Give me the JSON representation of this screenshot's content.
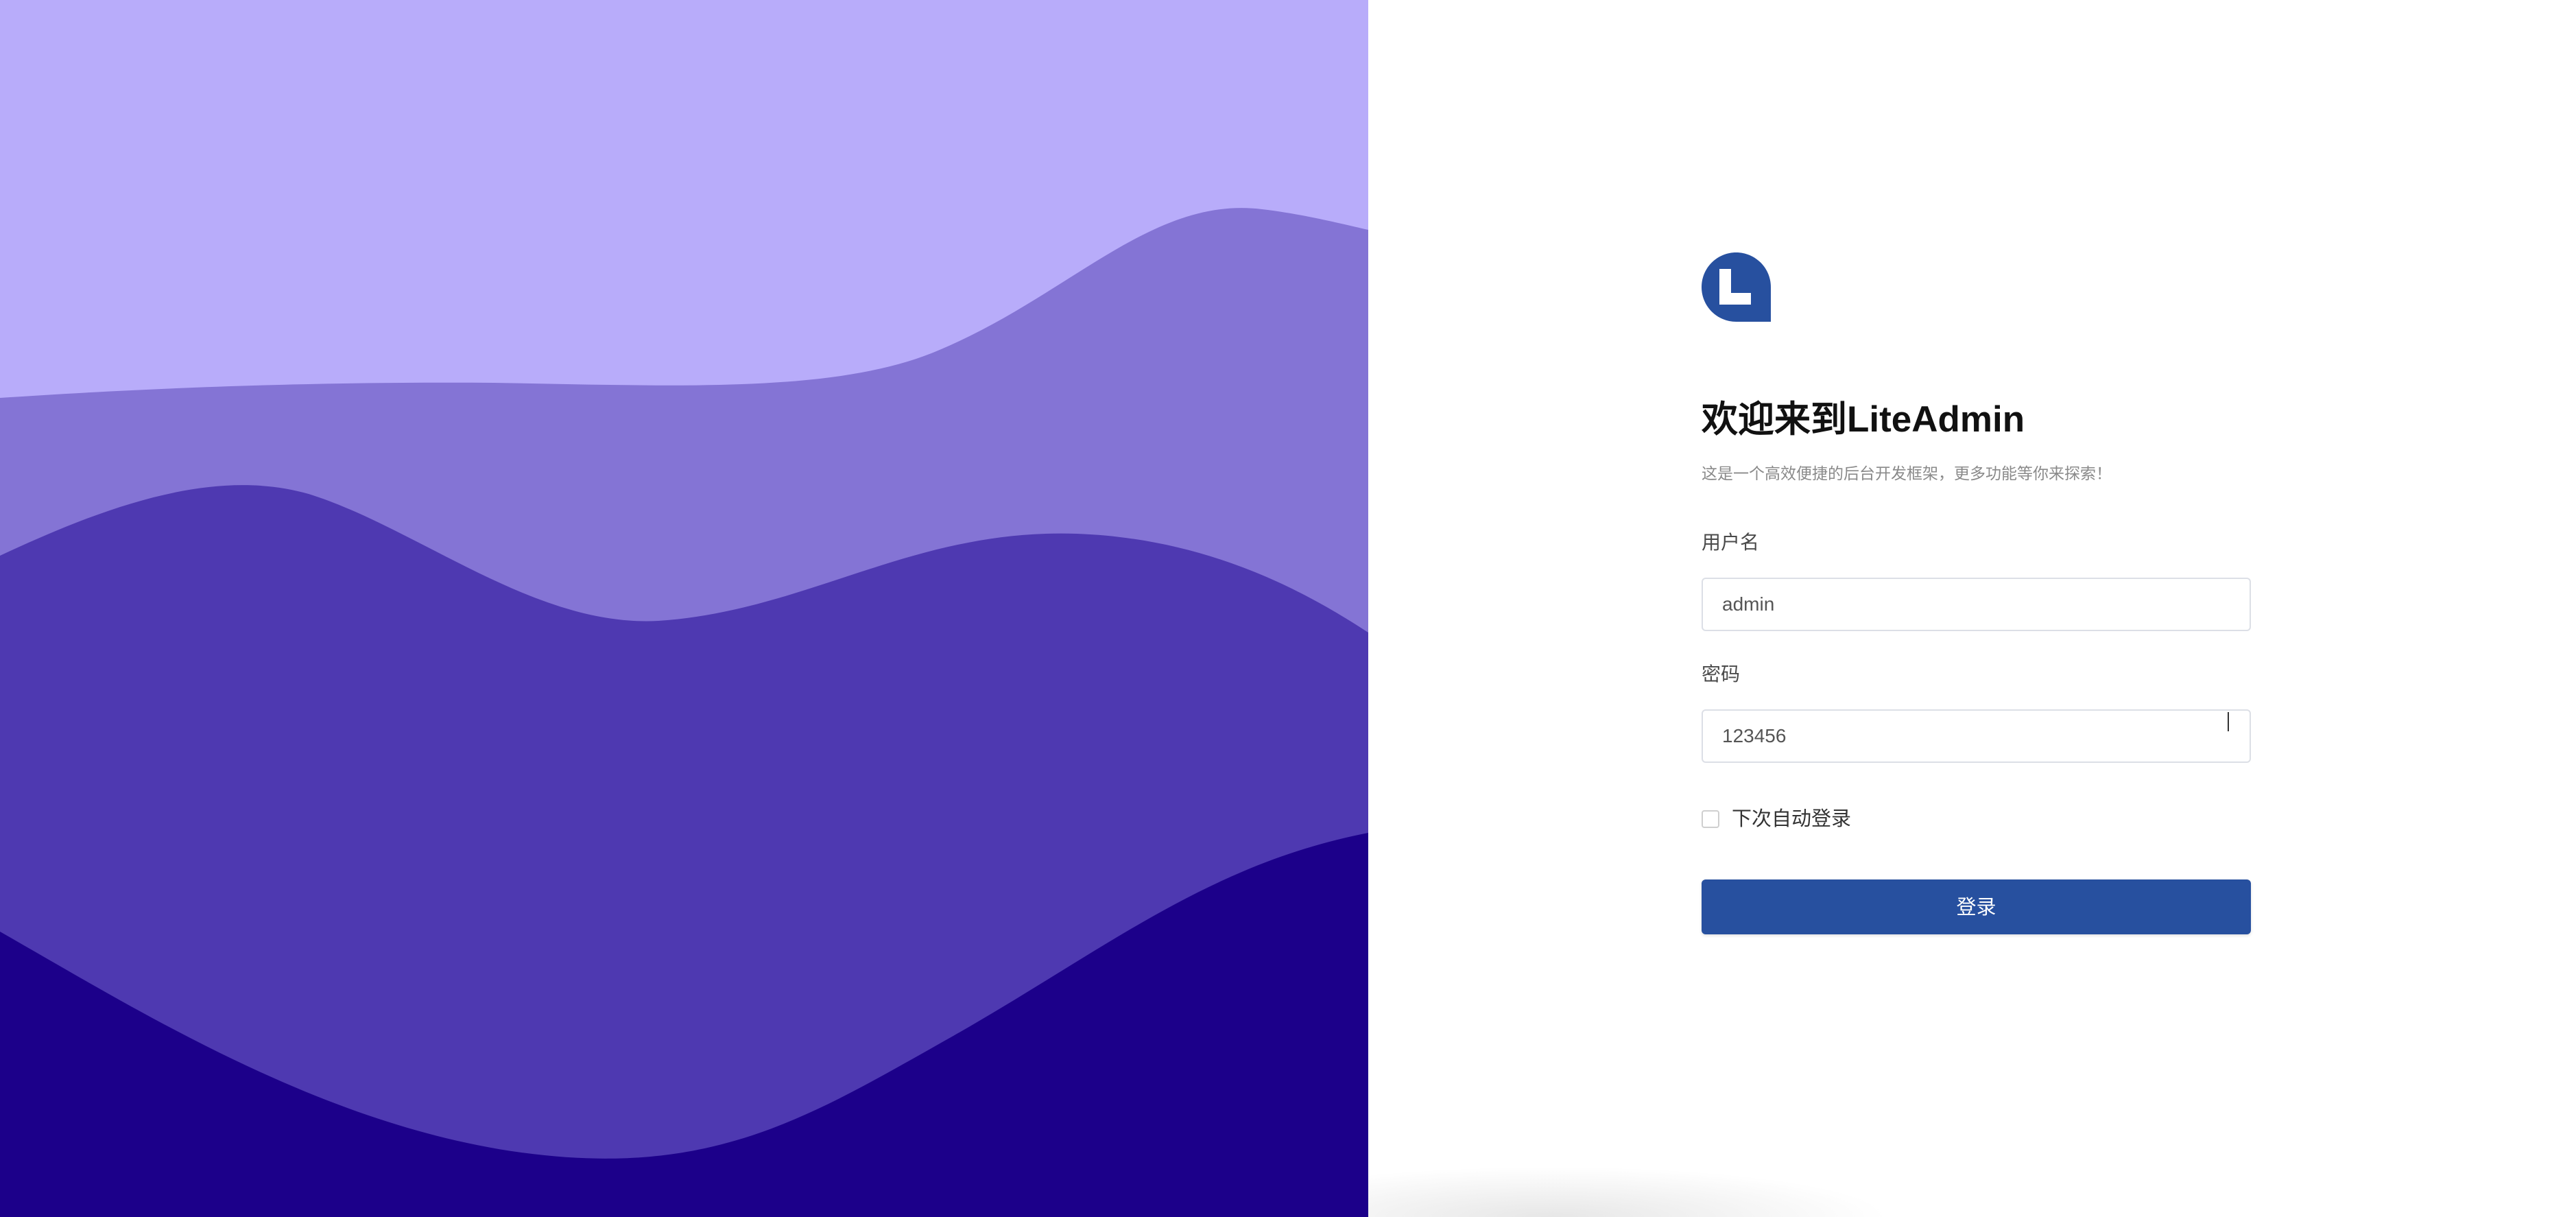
{
  "hero": {
    "colors": {
      "top": "#b8acfa",
      "layer1": "#8474d5",
      "layer2": "#4e39b1",
      "layer3": "#1c008a"
    }
  },
  "branding": {
    "logo_icon": "liteadmin-logo-icon",
    "logo_color": "#27509f",
    "logo_letter": "L"
  },
  "login": {
    "title": "欢迎来到LiteAdmin",
    "subtitle": "这是一个高效便捷的后台开发框架，更多功能等你来探索！",
    "username_label": "用户名",
    "username_value": "admin",
    "password_label": "密码",
    "password_value": "123456",
    "remember_label": "下次自动登录",
    "submit_label": "登录"
  }
}
